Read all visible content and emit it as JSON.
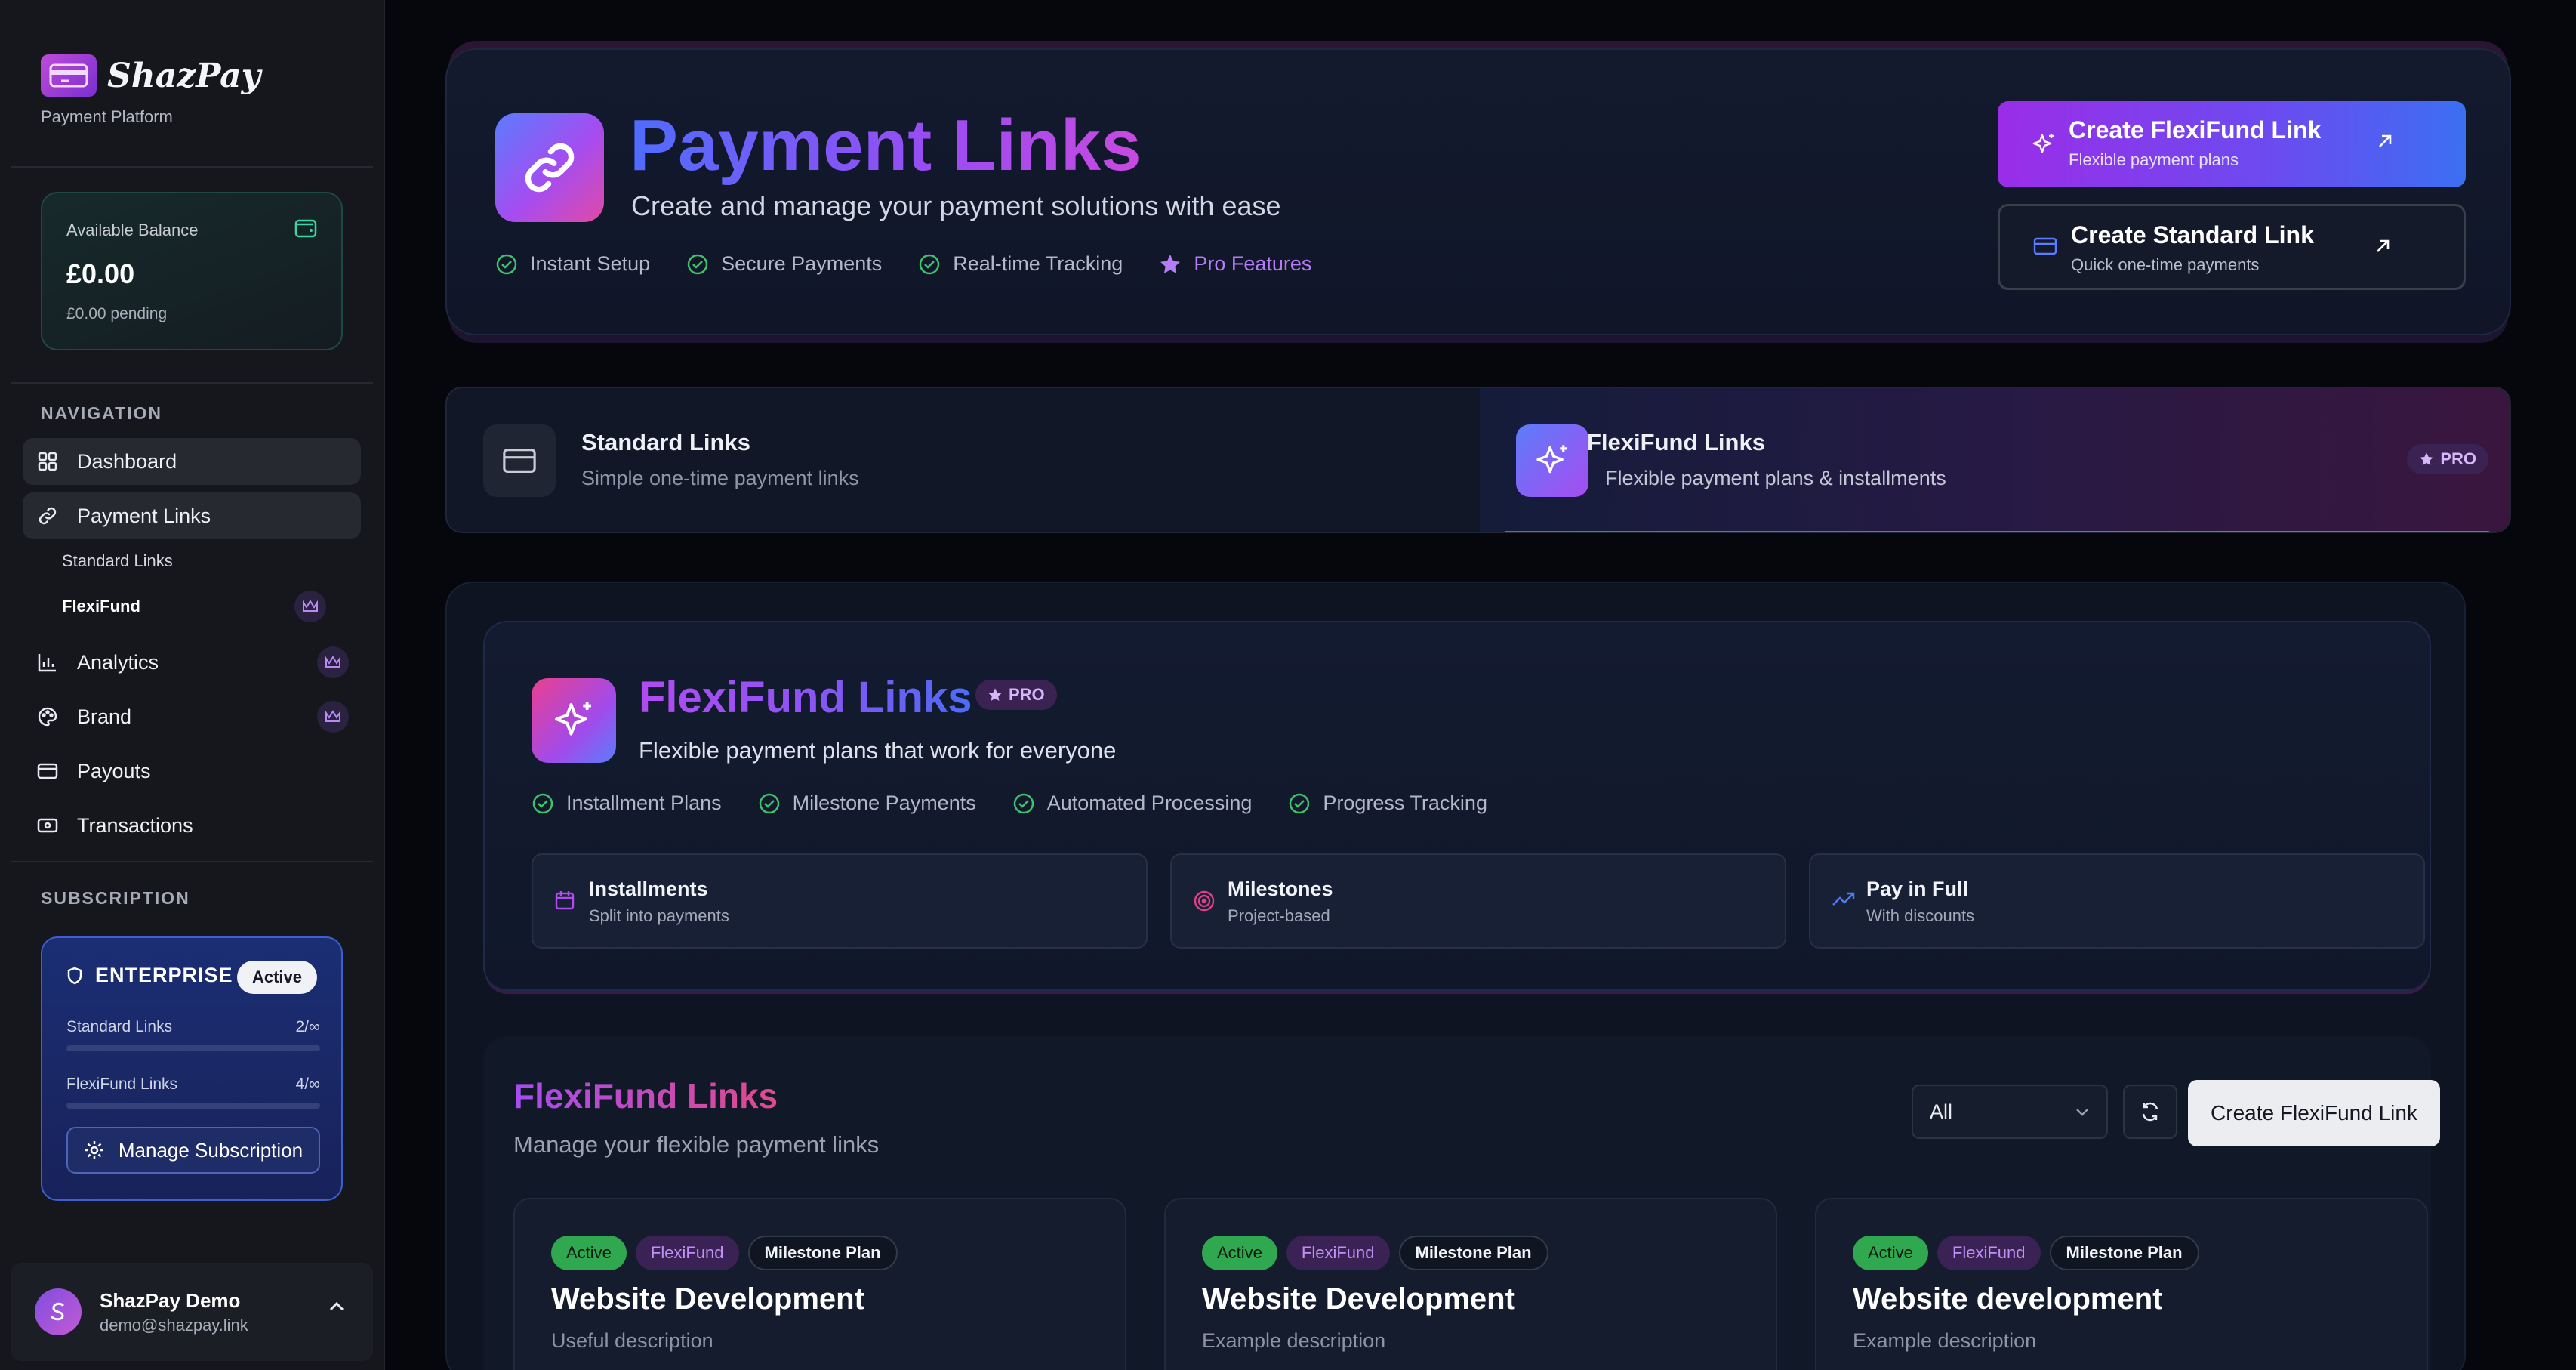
{
  "sidebar": {
    "brand_name": "ShazPay",
    "brand_subtitle": "Payment Platform",
    "balance": {
      "label": "Available Balance",
      "amount": "£0.00",
      "pending": "£0.00 pending"
    },
    "nav_heading": "NAVIGATION",
    "nav": [
      {
        "label": "Dashboard",
        "icon": "grid-icon"
      },
      {
        "label": "Payment Links",
        "icon": "link-icon"
      },
      {
        "label": "Analytics",
        "icon": "bar-chart-icon"
      },
      {
        "label": "Brand",
        "icon": "palette-icon"
      },
      {
        "label": "Payouts",
        "icon": "card-icon"
      },
      {
        "label": "Transactions",
        "icon": "banknote-icon"
      }
    ],
    "payment_links_sub": [
      "Standard Links",
      "FlexiFund"
    ],
    "subscription_heading": "SUBSCRIPTION",
    "subscription": {
      "tier": "ENTERPRISE",
      "status": "Active",
      "usage": [
        {
          "label": "Standard Links",
          "value": "2/∞"
        },
        {
          "label": "FlexiFund Links",
          "value": "4/∞"
        }
      ],
      "manage_label": "Manage Subscription"
    },
    "user": {
      "name": "ShazPay Demo",
      "email": "demo@shazpay.link"
    }
  },
  "hero": {
    "title": "Payment Links",
    "subtitle": "Create and manage your payment solutions with ease",
    "features": [
      "Instant Setup",
      "Secure Payments",
      "Real-time Tracking",
      "Pro Features"
    ],
    "create_flexi": {
      "title": "Create FlexiFund Link",
      "subtitle": "Flexible payment plans"
    },
    "create_standard": {
      "title": "Create Standard Link",
      "subtitle": "Quick one-time payments"
    }
  },
  "tabs": {
    "standard": {
      "title": "Standard Links",
      "subtitle": "Simple one-time payment links"
    },
    "flexi": {
      "title": "FlexiFund Links",
      "subtitle": "Flexible payment plans & installments",
      "badge": "PRO"
    }
  },
  "flexifund": {
    "title": "FlexiFund Links",
    "badge": "PRO",
    "subtitle": "Flexible payment plans that work for everyone",
    "features": [
      "Installment Plans",
      "Milestone Payments",
      "Automated Processing",
      "Progress Tracking"
    ],
    "options": [
      {
        "title": "Installments",
        "subtitle": "Split into payments",
        "icon": "calendar-icon"
      },
      {
        "title": "Milestones",
        "subtitle": "Project-based",
        "icon": "target-icon"
      },
      {
        "title": "Pay in Full",
        "subtitle": "With discounts",
        "icon": "trending-up-icon"
      }
    ]
  },
  "list": {
    "title": "FlexiFund Links",
    "subtitle": "Manage your flexible payment links",
    "filter_value": "All",
    "create_label": "Create FlexiFund Link",
    "cards": [
      {
        "badges": [
          "Active",
          "FlexiFund",
          "Milestone Plan"
        ],
        "title": "Website Development",
        "description": "Useful description"
      },
      {
        "badges": [
          "Active",
          "FlexiFund",
          "Milestone Plan"
        ],
        "title": "Website Development",
        "description": "Example description"
      },
      {
        "badges": [
          "Active",
          "FlexiFund",
          "Milestone Plan"
        ],
        "title": "Website development",
        "description": "Example description"
      }
    ]
  },
  "colors": {
    "accent_purple": "#9b2de8",
    "accent_blue": "#3b6ff2",
    "success_green": "#2fa84f",
    "sidebar_bg": "#15171d",
    "page_bg": "#05070c"
  }
}
